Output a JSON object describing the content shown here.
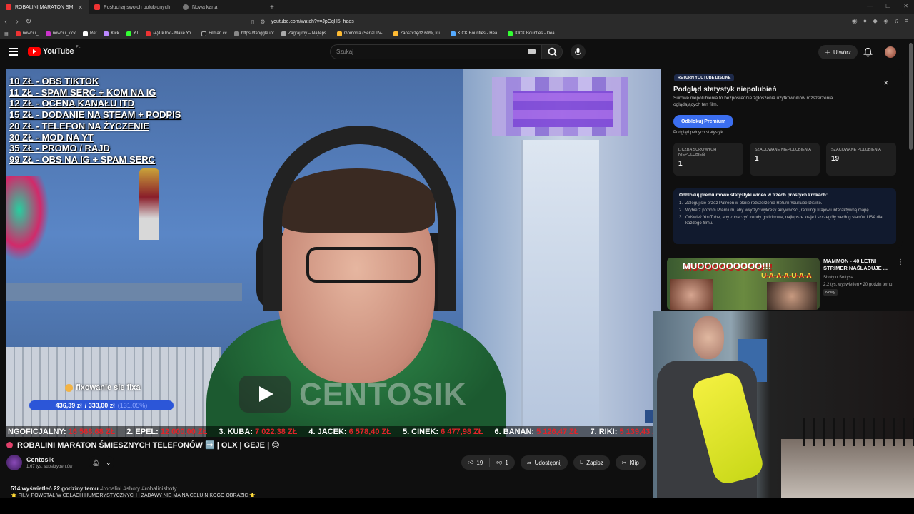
{
  "browser": {
    "tabs": [
      {
        "title": "ROBALINI MARATON ŚMI",
        "active": true,
        "color": "#e33"
      },
      {
        "title": "Posłuchaj swoich polubionych utwo",
        "active": false,
        "color": "#e33"
      },
      {
        "title": "Nowa karta",
        "active": false,
        "color": "#888"
      }
    ],
    "url": "youtube.com/watch?v=JpCqH5_haos",
    "bookmarks": [
      "nowciu_",
      "nowciu_kick",
      "Ret",
      "Kick",
      "YT",
      "(4)TikTok - Make Yo...",
      "Filman.cc",
      "https://tanggle.io/",
      "Zagraj.my – Najleps...",
      "Gomorra (Serial TV-...",
      "Zaoszczędź 60%, ku...",
      "KICK Bounties - Hea...",
      "KICK Bounties - Dea..."
    ]
  },
  "header": {
    "logo_text": "YouTube",
    "logo_region": "PL",
    "search_placeholder": "Szukaj",
    "create_label": "Utwórz"
  },
  "video": {
    "donations": [
      "10 ZŁ - OBS TIKTOK",
      "11 ZŁ - SPAM SERC + KOM NA IG",
      "12 ZŁ - OCENA KANAŁU ITD",
      "15 ZŁ - DODANIE NA STEAM + PODPIS",
      "20 ZŁ - TELEFON NA ŻYCZENIE",
      "30 ZŁ - MOD NA YT",
      "35 ZŁ - PROMO / RAJD",
      "99 ZŁ - OBS NA IG + SPAM SERC"
    ],
    "watermark": "CENTOSIK",
    "goal_label": "fixowanie sie fixa",
    "goal_current": "436,39 zł",
    "goal_target": "/ 333,00 zł",
    "goal_percent": "(131.05%)",
    "goal_fill_fraction": 1.0,
    "ticker": [
      {
        "name": "NGOFICJALNY:",
        "value": "16 568,68 ZŁ"
      },
      {
        "name": "2. EPEL:",
        "value": "12 000,00 ZŁ"
      },
      {
        "name": "3. KUBA:",
        "value": "7 022,38 ZŁ"
      },
      {
        "name": "4. JACEK:",
        "value": "6 578,40 ZŁ"
      },
      {
        "name": "5. CINEK:",
        "value": "6 477,98 ZŁ"
      },
      {
        "name": "6. BANAN:",
        "value": "5 126,47 ZŁ"
      },
      {
        "name": "7. RIKI:",
        "value": "5 139,43 ZŁ"
      }
    ],
    "title": "ROBALINI MARATON ŚMIESZNYCH TELEFONÓW ➡️ | OLX | GEJE | 😊",
    "channel": "Centosik",
    "subscribers": "1,67 tys. subskrybentów",
    "likes": "19",
    "dislikes": "1",
    "share_label": "Udostępnij",
    "save_label": "Zapisz",
    "clip_label": "Klip",
    "views_time": "514 wyświetleń  22 godziny temu",
    "hashtags": "#robalini #shoty #robalinishoty",
    "description_line": "⭐ FILM POWSTAŁ W CELACH HUMORYSTYCZNYCH I ZABAWY NIE MA NA CELU NIKOGO OBRAZIĆ ⭐"
  },
  "ryd": {
    "badge": "RETURN YOUTUBE DISLIKE",
    "title": "Podgląd statystyk niepolubień",
    "description": "Surowe niepolubienia to bezpośrednie zgłoszenia użytkowników rozszerzenia oglądających ten film.",
    "button": "Odblokuj Premium",
    "small": "Podgląd pełnych statystyk",
    "stats": [
      {
        "label": "LICZBA SUROWYCH NIEPOLUBIEŃ",
        "value": "1"
      },
      {
        "label": "SZACOWANE NIEPOLUBIENIA",
        "value": "1"
      },
      {
        "label": "SZACOWANE POLUBIENIA",
        "value": "19"
      }
    ],
    "steps_header": "Odblokuj premiumowe statystyki wideo w trzech prostych krokach:",
    "steps": [
      "Zaloguj się przez Patreon w oknie rozszerzenia Return YouTube Dislike.",
      "Wybierz poziom Premium, aby włączyć wykresy aktywności, rankingi krajów i interaktywną mapę.",
      "Odśwież YouTube, aby zobaczyć trendy godzinowe, najlepsze kraje i szczegóły według stanów USA dla każdego filmu."
    ]
  },
  "recommended": {
    "thumb_text1": "MUOOOOOOOOO!!!",
    "thumb_text2": "U-A-A-A-U-A-A",
    "title": "MAMMON - 40 LETNI STRIMER NAŚLADUJE ...",
    "channel": "Shoty u Softysa",
    "meta": "2,2 tys. wyświetleń • 20 godzin temu",
    "badge": "Nowy"
  }
}
